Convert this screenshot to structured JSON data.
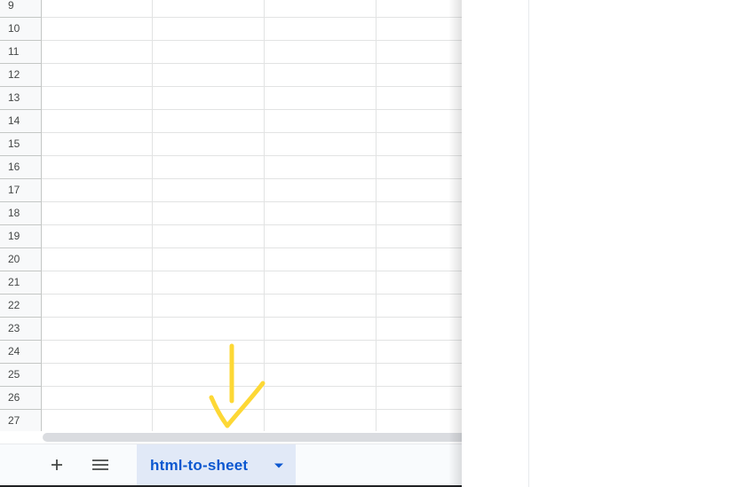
{
  "grid": {
    "rows": [
      {
        "number": "9"
      },
      {
        "number": "10"
      },
      {
        "number": "11"
      },
      {
        "number": "12"
      },
      {
        "number": "13"
      },
      {
        "number": "14"
      },
      {
        "number": "15"
      },
      {
        "number": "16"
      },
      {
        "number": "17"
      },
      {
        "number": "18"
      },
      {
        "number": "19"
      },
      {
        "number": "20"
      },
      {
        "number": "21"
      },
      {
        "number": "22"
      },
      {
        "number": "23"
      },
      {
        "number": "24"
      },
      {
        "number": "25"
      },
      {
        "number": "26"
      },
      {
        "number": "27"
      }
    ]
  },
  "sheet_bar": {
    "add_icon": "plus-icon",
    "all_sheets_icon": "menu-icon",
    "active_tab": {
      "label": "html-to-sheet",
      "caret_icon": "caret-down-icon"
    }
  },
  "annotation": {
    "icon": "hand-drawn-arrow-icon",
    "color": "#fdd835"
  },
  "colors": {
    "tab_active_bg": "#e1e9f7",
    "tab_active_text": "#0b57d0",
    "gridline": "#e2e3e3",
    "header_bg": "#f8f9fa"
  }
}
